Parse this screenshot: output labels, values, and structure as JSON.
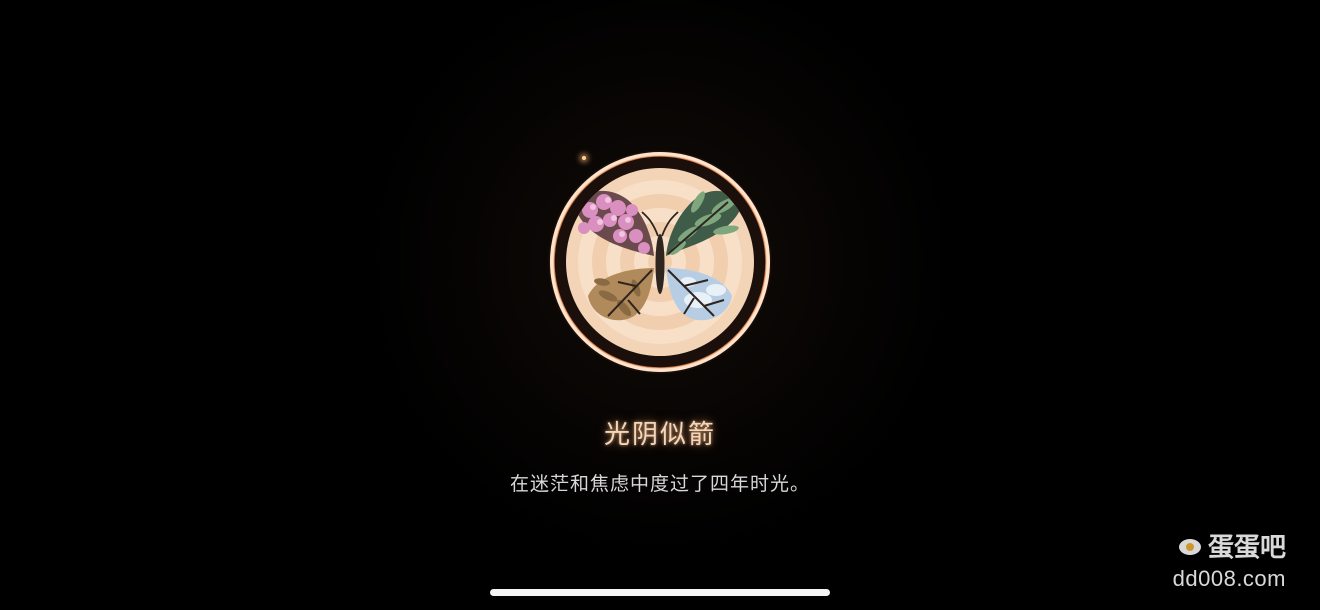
{
  "achievement": {
    "title": "光阴似箭",
    "description": "在迷茫和焦虑中度过了四年时光。",
    "icon": "four-seasons-butterfly-icon"
  },
  "watermark": {
    "name": "蛋蛋吧",
    "url": "dd008.com"
  },
  "colors": {
    "background": "#000000",
    "glow": "#ffb07a",
    "title": "#f3d7bd",
    "description": "#d8d8d8"
  }
}
